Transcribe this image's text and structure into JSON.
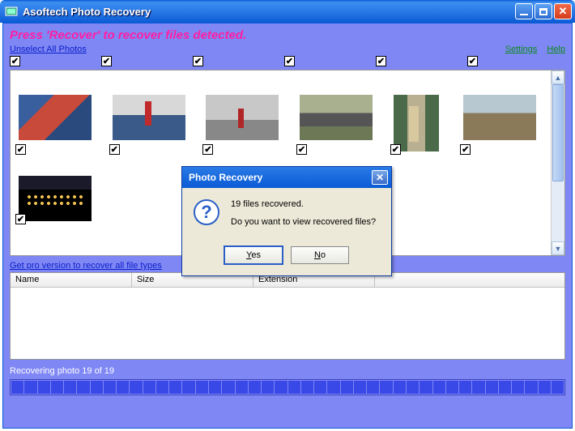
{
  "window": {
    "title": "Asoftech Photo Recovery"
  },
  "instruction": "Press 'Recover' to recover files detected.",
  "links": {
    "unselect": "Unselect All Photos",
    "settings": "Settings",
    "help": "Help",
    "pro": "Get pro version to recover all file types"
  },
  "table": {
    "columns": {
      "name": "Name",
      "size": "Size",
      "ext": "Extension"
    }
  },
  "status": "Recovering photo 19 of 19",
  "progress": {
    "segments": 42,
    "filled": 42
  },
  "dialog": {
    "title": "Photo Recovery",
    "line1": "19 files recovered.",
    "line2": "Do you want to view recovered files?",
    "yes": "Yes",
    "no": "No"
  }
}
